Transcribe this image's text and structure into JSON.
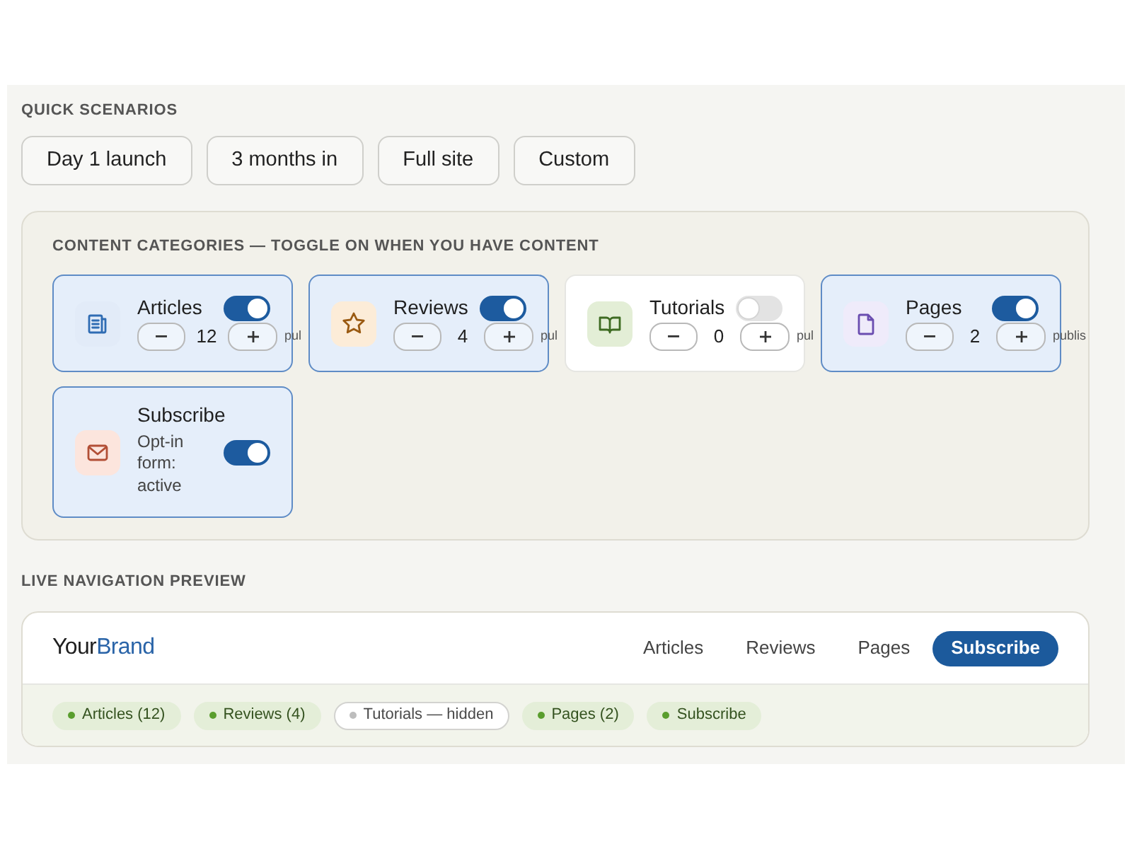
{
  "quick_scenarios": {
    "heading": "QUICK SCENARIOS",
    "buttons": [
      "Day 1 launch",
      "3 months in",
      "Full site",
      "Custom"
    ]
  },
  "content_categories": {
    "heading": "CONTENT CATEGORIES — TOGGLE ON WHEN YOU HAVE CONTENT",
    "cards": [
      {
        "kind": "counter",
        "title": "Articles",
        "on": true,
        "count": "12",
        "note": "pul"
      },
      {
        "kind": "counter",
        "title": "Reviews",
        "on": true,
        "count": "4",
        "note": "pul"
      },
      {
        "kind": "counter",
        "title": "Tutorials",
        "on": false,
        "count": "0",
        "note": "pul"
      },
      {
        "kind": "counter",
        "title": "Pages",
        "on": true,
        "count": "2",
        "note": "publis"
      },
      {
        "kind": "status",
        "title": "Subscribe",
        "on": true,
        "status": "Opt-in form: active"
      }
    ]
  },
  "navigation_preview": {
    "heading": "LIVE NAVIGATION PREVIEW",
    "brand": {
      "text": "Your",
      "accent": "Brand"
    },
    "links": [
      {
        "kind": "link",
        "label": "Articles"
      },
      {
        "kind": "link",
        "label": "Reviews"
      },
      {
        "kind": "link",
        "label": "Pages"
      },
      {
        "kind": "cta",
        "label": "Subscribe"
      }
    ],
    "chips": [
      {
        "label": "Articles (12)",
        "visible": true
      },
      {
        "label": "Reviews (4)",
        "visible": true
      },
      {
        "label": "Tutorials — hidden",
        "visible": false
      },
      {
        "label": "Pages (2)",
        "visible": true
      },
      {
        "label": "Subscribe",
        "visible": true
      }
    ]
  }
}
